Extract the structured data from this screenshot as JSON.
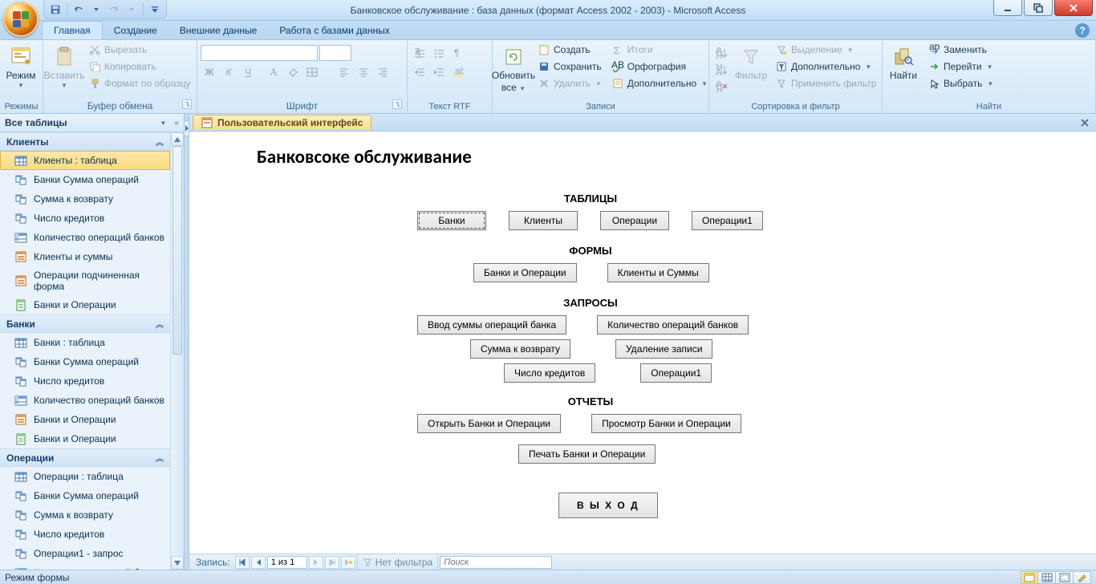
{
  "title": "Банковское обслуживание : база данных (формат Access 2002 - 2003) - Microsoft Access",
  "ribbon_tabs": {
    "t0": "Главная",
    "t1": "Создание",
    "t2": "Внешние данные",
    "t3": "Работа с базами данных"
  },
  "groups": {
    "views": {
      "label": "Режимы",
      "view_btn": "Режим"
    },
    "clipboard": {
      "label": "Буфер обмена",
      "paste": "Вставить",
      "cut": "Вырезать",
      "copy": "Копировать",
      "painter": "Формат по образцу"
    },
    "font": {
      "label": "Шрифт"
    },
    "richtext": {
      "label": "Текст RTF"
    },
    "records": {
      "label": "Записи",
      "refresh_top": "Обновить",
      "refresh_bottom": "все",
      "new": "Создать",
      "save": "Сохранить",
      "delete": "Удалить",
      "totals": "Итоги",
      "spelling": "Орфография",
      "more": "Дополнительно"
    },
    "sortfilter": {
      "label": "Сортировка и фильтр",
      "filter": "Фильтр",
      "selection": "Выделение",
      "advanced": "Дополнительно",
      "toggle": "Применить фильтр"
    },
    "find": {
      "label": "Найти",
      "find": "Найти",
      "replace": "Заменить",
      "goto": "Перейти",
      "select": "Выбрать"
    }
  },
  "navpane": {
    "header": "Все таблицы",
    "groups": [
      {
        "title": "Клиенты",
        "items": [
          {
            "icon": "table",
            "label": "Клиенты : таблица",
            "selected": true
          },
          {
            "icon": "query",
            "label": "Банки Сумма операций"
          },
          {
            "icon": "query",
            "label": "Сумма к возврату"
          },
          {
            "icon": "query",
            "label": "Число кредитов"
          },
          {
            "icon": "query-cross",
            "label": "Количество операций банков"
          },
          {
            "icon": "form",
            "label": "Клиенты и суммы"
          },
          {
            "icon": "form",
            "label": "Операции подчиненная форма"
          },
          {
            "icon": "report",
            "label": "Банки и Операции"
          }
        ]
      },
      {
        "title": "Банки",
        "items": [
          {
            "icon": "table",
            "label": "Банки : таблица"
          },
          {
            "icon": "query",
            "label": "Банки Сумма операций"
          },
          {
            "icon": "query",
            "label": "Число кредитов"
          },
          {
            "icon": "query-cross",
            "label": "Количество операций банков"
          },
          {
            "icon": "form",
            "label": "Банки и Операции"
          },
          {
            "icon": "report",
            "label": "Банки и Операции"
          }
        ]
      },
      {
        "title": "Операции",
        "items": [
          {
            "icon": "table",
            "label": "Операции : таблица"
          },
          {
            "icon": "query",
            "label": "Банки Сумма операций"
          },
          {
            "icon": "query",
            "label": "Сумма к возврату"
          },
          {
            "icon": "query",
            "label": "Число кредитов"
          },
          {
            "icon": "query",
            "label": "Операции1 - запрос"
          },
          {
            "icon": "query-cross",
            "label": "Количество операций банков"
          }
        ]
      }
    ]
  },
  "doc": {
    "tab": "Пользовательский интерфейс",
    "title": "Банковсоке обслуживание",
    "sections": {
      "tables": {
        "label": "ТАБЛИЦЫ",
        "b0": "Банки",
        "b1": "Клиенты",
        "b2": "Операции",
        "b3": "Операции1"
      },
      "forms": {
        "label": "ФОРМЫ",
        "b0": "Банки и Операции",
        "b1": "Клиенты и Суммы"
      },
      "queries": {
        "label": "ЗАПРОСЫ",
        "b0": "Ввод суммы операций банка",
        "b1": "Количество операций банков",
        "b2": "Сумма к возврату",
        "b3": "Удаление записи",
        "b4": "Число кредитов",
        "b5": "Операции1"
      },
      "reports": {
        "label": "ОТЧЕТЫ",
        "b0": "Открыть Банки и Операции",
        "b1": "Просмотр Банки и Операции",
        "b2": "Печать Банки и Операции"
      },
      "exit": "В Ы Х О Д"
    },
    "recnav": {
      "label": "Запись:",
      "value": "1 из 1",
      "nofilter": "Нет фильтра",
      "search": "Поиск"
    }
  },
  "statusbar": "Режим формы"
}
